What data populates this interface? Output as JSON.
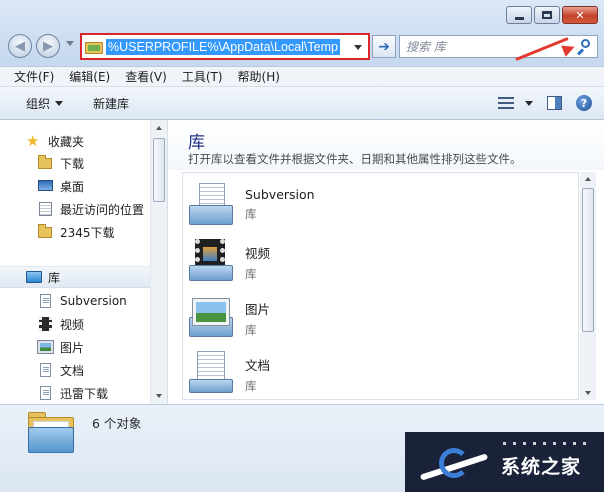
{
  "address": {
    "path": "%USERPROFILE%\\AppData\\Local\\Temp"
  },
  "search": {
    "placeholder": "搜索 库"
  },
  "menu": [
    "文件(F)",
    "编辑(E)",
    "查看(V)",
    "工具(T)",
    "帮助(H)"
  ],
  "toolbar": {
    "organize": "组织",
    "new_library": "新建库"
  },
  "nav": {
    "favorites": "收藏夹",
    "favorites_items": [
      "下载",
      "桌面",
      "最近访问的位置",
      "2345下载"
    ],
    "libraries": "库",
    "library_items": [
      "Subversion",
      "视频",
      "图片",
      "文档",
      "迅雷下载"
    ]
  },
  "content": {
    "title": "库",
    "description": "打开库以查看文件并根据文件夹、日期和其他属性排列这些文件。",
    "items": [
      {
        "name": "Subversion",
        "sub": "库"
      },
      {
        "name": "视频",
        "sub": "库"
      },
      {
        "name": "图片",
        "sub": "库"
      },
      {
        "name": "文档",
        "sub": "库"
      }
    ]
  },
  "status": {
    "count": "6 个对象"
  },
  "watermark": {
    "text": "系统之家"
  },
  "colors": {
    "highlight": "#d9262b",
    "selection": "#3399ff",
    "accent_arrow": "#e33b32"
  }
}
